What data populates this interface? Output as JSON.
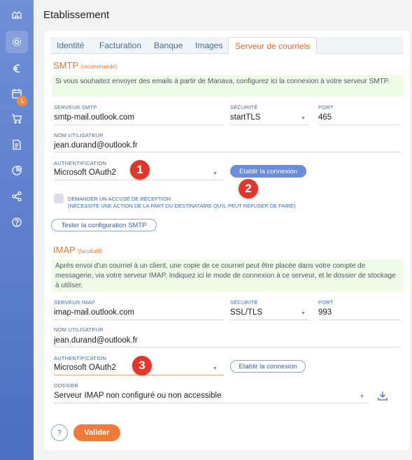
{
  "page_title": "Etablissement",
  "sidebar": {
    "badge": "1",
    "icons": [
      "home-icon",
      "gear-icon",
      "euro-icon",
      "calendar-icon",
      "cart-icon",
      "document-icon",
      "pie-chart-icon",
      "share-icon",
      "help-icon"
    ]
  },
  "tabs": [
    "Identité",
    "Facturation",
    "Banque",
    "Images",
    "Serveur de courriels"
  ],
  "smtp": {
    "title": "SMTP",
    "tag": "(recommandé)",
    "info": "Si vous souhaitez envoyer des emails à partir de Manava, configurez ici la connexion à votre serveur SMTP.",
    "server_label": "SERVEUR SMTP",
    "server_value": "smtp-mail.outlook.com",
    "security_label": "SÉCURITÉ",
    "security_value": "startTLS",
    "port_label": "PORT",
    "port_value": "465",
    "user_label": "NOM UTILISATEUR",
    "user_value": "jean.durand@outlook.fr",
    "auth_label": "AUTHENTIFICATION",
    "auth_value": "Microsoft OAuth2",
    "connect_label": "Etablir la connexion",
    "receipt_line1": "DEMANDER UN ACCUSÉ DE RÉCEPTION",
    "receipt_line2": "(NÉCESSITE UNE ACTION DE LA PART DU DESTINATAIRE QU'IL PEUT REFUSER DE FAIRE)",
    "test_label": "Tester la configuration SMTP"
  },
  "imap": {
    "title": "IMAP",
    "tag": "(facultatif)",
    "info": "Après envoi d'un courriel à un client, une copie de ce courriel peut être placée dans votre compte de messagerie, via votre serveur IMAP. Indiquez ici le mode de connexion à ce serveur, et le dossier de stockage à utiliser.",
    "server_label": "SERVEUR IMAP",
    "server_value": "imap-mail.outlook.com",
    "security_label": "SÉCURITÉ",
    "security_value": "SSL/TLS",
    "port_label": "PORT",
    "port_value": "993",
    "user_label": "NOM UTILISATEUR",
    "user_value": "jean.durand@outlook.fr",
    "auth_label": "AUTHENTIFICATION",
    "auth_value": "Microsoft OAuth2",
    "connect_label": "Etablir la connexion",
    "folder_label": "DOSSIER",
    "folder_value": "Serveur IMAP non configuré ou non accessible"
  },
  "markers": [
    "1",
    "2",
    "3"
  ],
  "footer": {
    "help": "?",
    "validate": "Valider"
  },
  "colors": {
    "accent": "#e8762c",
    "sidebar": "#5a7ccb",
    "marker": "#e0362c",
    "link": "#3a67b8"
  }
}
